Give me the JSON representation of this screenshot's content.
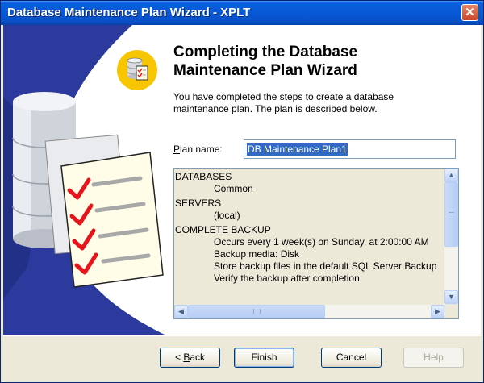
{
  "window": {
    "title": "Database Maintenance Plan Wizard - XPLT"
  },
  "header": {
    "title_line1": "Completing the Database",
    "title_line2": "Maintenance Plan Wizard",
    "description_line1": "You have completed the steps to create a database",
    "description_line2": "maintenance plan. The plan is described below."
  },
  "plan": {
    "label_prefix": "",
    "label_accel": "P",
    "label_rest": "lan name:",
    "value": "DB Maintenance Plan1"
  },
  "summary": {
    "sections": [
      {
        "heading": "DATABASES",
        "items": [
          "Common"
        ]
      },
      {
        "heading": "SERVERS",
        "items": [
          "(local)"
        ]
      },
      {
        "heading": "COMPLETE BACKUP",
        "items": [
          "Occurs every 1 week(s) on Sunday, at 2:00:00 AM",
          "Backup media: Disk",
          "Store backup files in the default SQL Server Backup",
          "Verify the backup after completion"
        ]
      }
    ]
  },
  "buttons": {
    "back_prefix": "< ",
    "back_accel": "B",
    "back_rest": "ack",
    "finish": "Finish",
    "cancel": "Cancel",
    "help": "Help"
  },
  "icons": {
    "close": "close-icon",
    "scroll_up": "scroll-up-icon",
    "scroll_down": "scroll-down-icon",
    "scroll_left": "scroll-left-icon",
    "scroll_right": "scroll-right-icon",
    "header": "database-checklist-icon"
  },
  "colors": {
    "titlebar": "#0858d6",
    "art_blue": "#2b3a9c",
    "check_red": "#e8141b",
    "selection": "#316ac5"
  }
}
